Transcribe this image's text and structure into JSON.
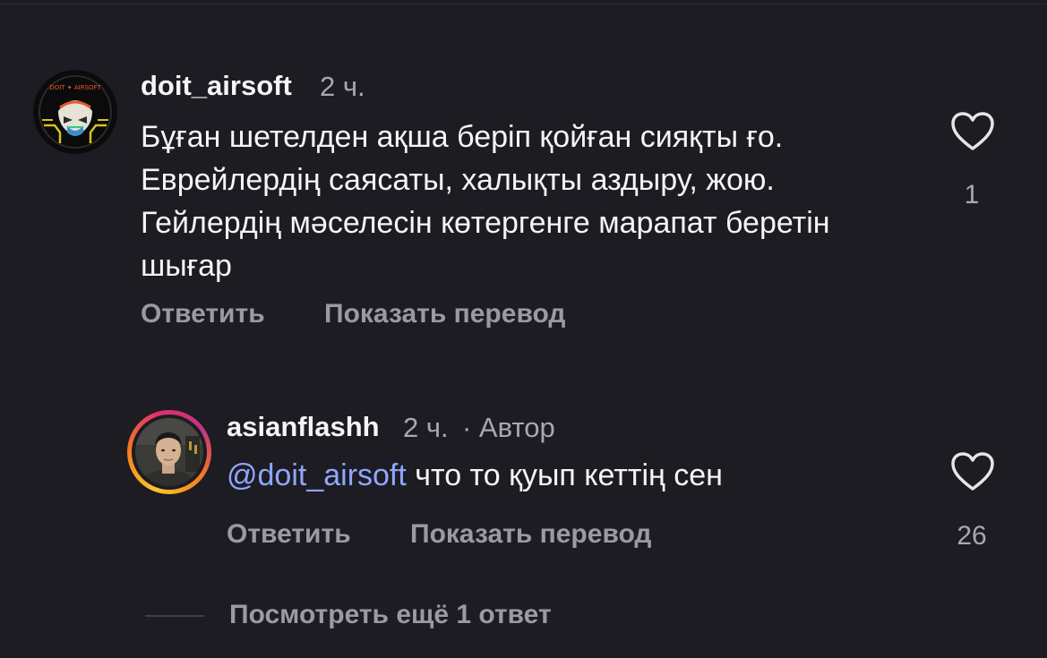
{
  "comments": [
    {
      "username": "doit_airsoft",
      "time": "2 ч.",
      "text": "Бұған шетелден ақша беріп қойған сияқты ғо. Еврейлердің саясаты, халықты аздыру, жою. Гейлердің мәселесін көтергенге марапат беретін шығар",
      "reply_label": "Ответить",
      "translate_label": "Показать перевод",
      "like_count": "1",
      "avatar_text": "DOIT AIRSOFT"
    },
    {
      "username": "asianflashh",
      "time": "2 ч.",
      "author_label": "· Автор",
      "mention": "@doit_airsoft",
      "text": " что то қуып кеттің сен",
      "reply_label": "Ответить",
      "translate_label": "Показать перевод",
      "like_count": "26"
    }
  ],
  "view_more_replies": "Посмотреть ещё 1 ответ",
  "colors": {
    "background": "#1c1c22",
    "mention": "#8fa6ff",
    "secondary_text": "#a8a8b0"
  }
}
